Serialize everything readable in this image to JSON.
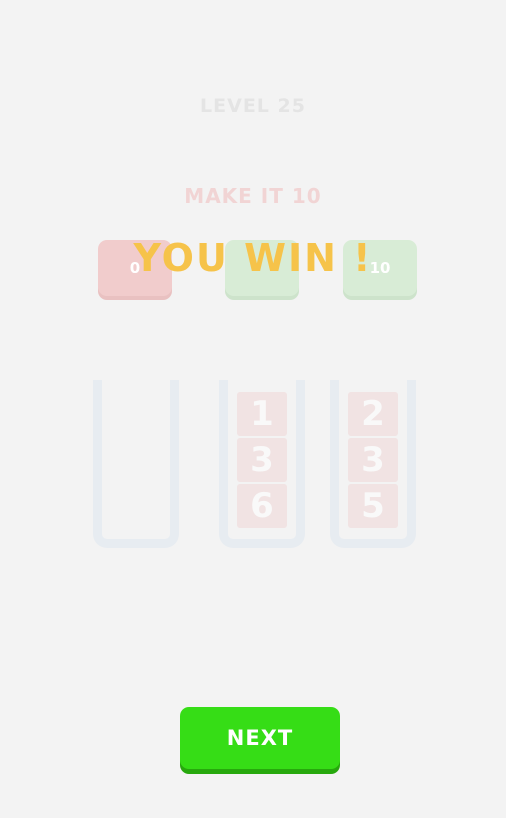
{
  "level": {
    "label": "LEVEL 25"
  },
  "goal": {
    "label": "MAKE IT 10"
  },
  "targets": [
    {
      "value": "0",
      "color": "#f1cccc"
    },
    {
      "value": "",
      "color": "#d8ecd6"
    },
    {
      "value": "10",
      "color": "#d8ecd6"
    }
  ],
  "result": {
    "label": "YOU WIN !"
  },
  "tubes": [
    {
      "blocks": []
    },
    {
      "blocks": [
        "1",
        "3",
        "6"
      ]
    },
    {
      "blocks": [
        "2",
        "3",
        "5"
      ]
    }
  ],
  "actions": {
    "next_label": "NEXT",
    "next_color": "#36dd16"
  }
}
